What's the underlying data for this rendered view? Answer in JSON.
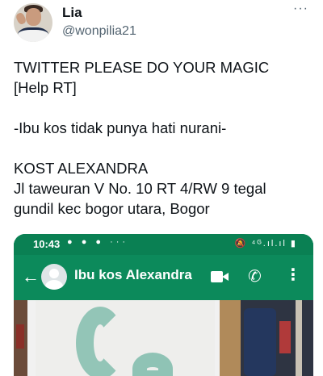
{
  "tweet": {
    "display_name": "Lia",
    "handle": "@wonpilia21",
    "more_label": "···",
    "text_lines": [
      "TWITTER PLEASE DO YOUR MAGIC",
      "[Help RT]",
      "",
      "-Ibu kos tidak punya hati nurani-",
      "",
      "KOST ALEXANDRA",
      "Jl taweuran V No. 10 RT 4/RW 9 tegal",
      "gundil kec bogor utara, Bogor"
    ]
  },
  "embedded_screenshot": {
    "status_bar": {
      "time": "10:43",
      "notification_dots": "● ● ● ···",
      "system_icons": "🔕 ⁴ᴳ.ıl.ıl ▮"
    },
    "app_bar": {
      "back_icon": "←",
      "contact_name": "Ibu kos Alexandra",
      "phone_icon": "✆",
      "menu_icon": "⋮"
    },
    "colors": {
      "whatsapp_green": "#0c8a5b",
      "status_green": "#0a8053"
    }
  }
}
